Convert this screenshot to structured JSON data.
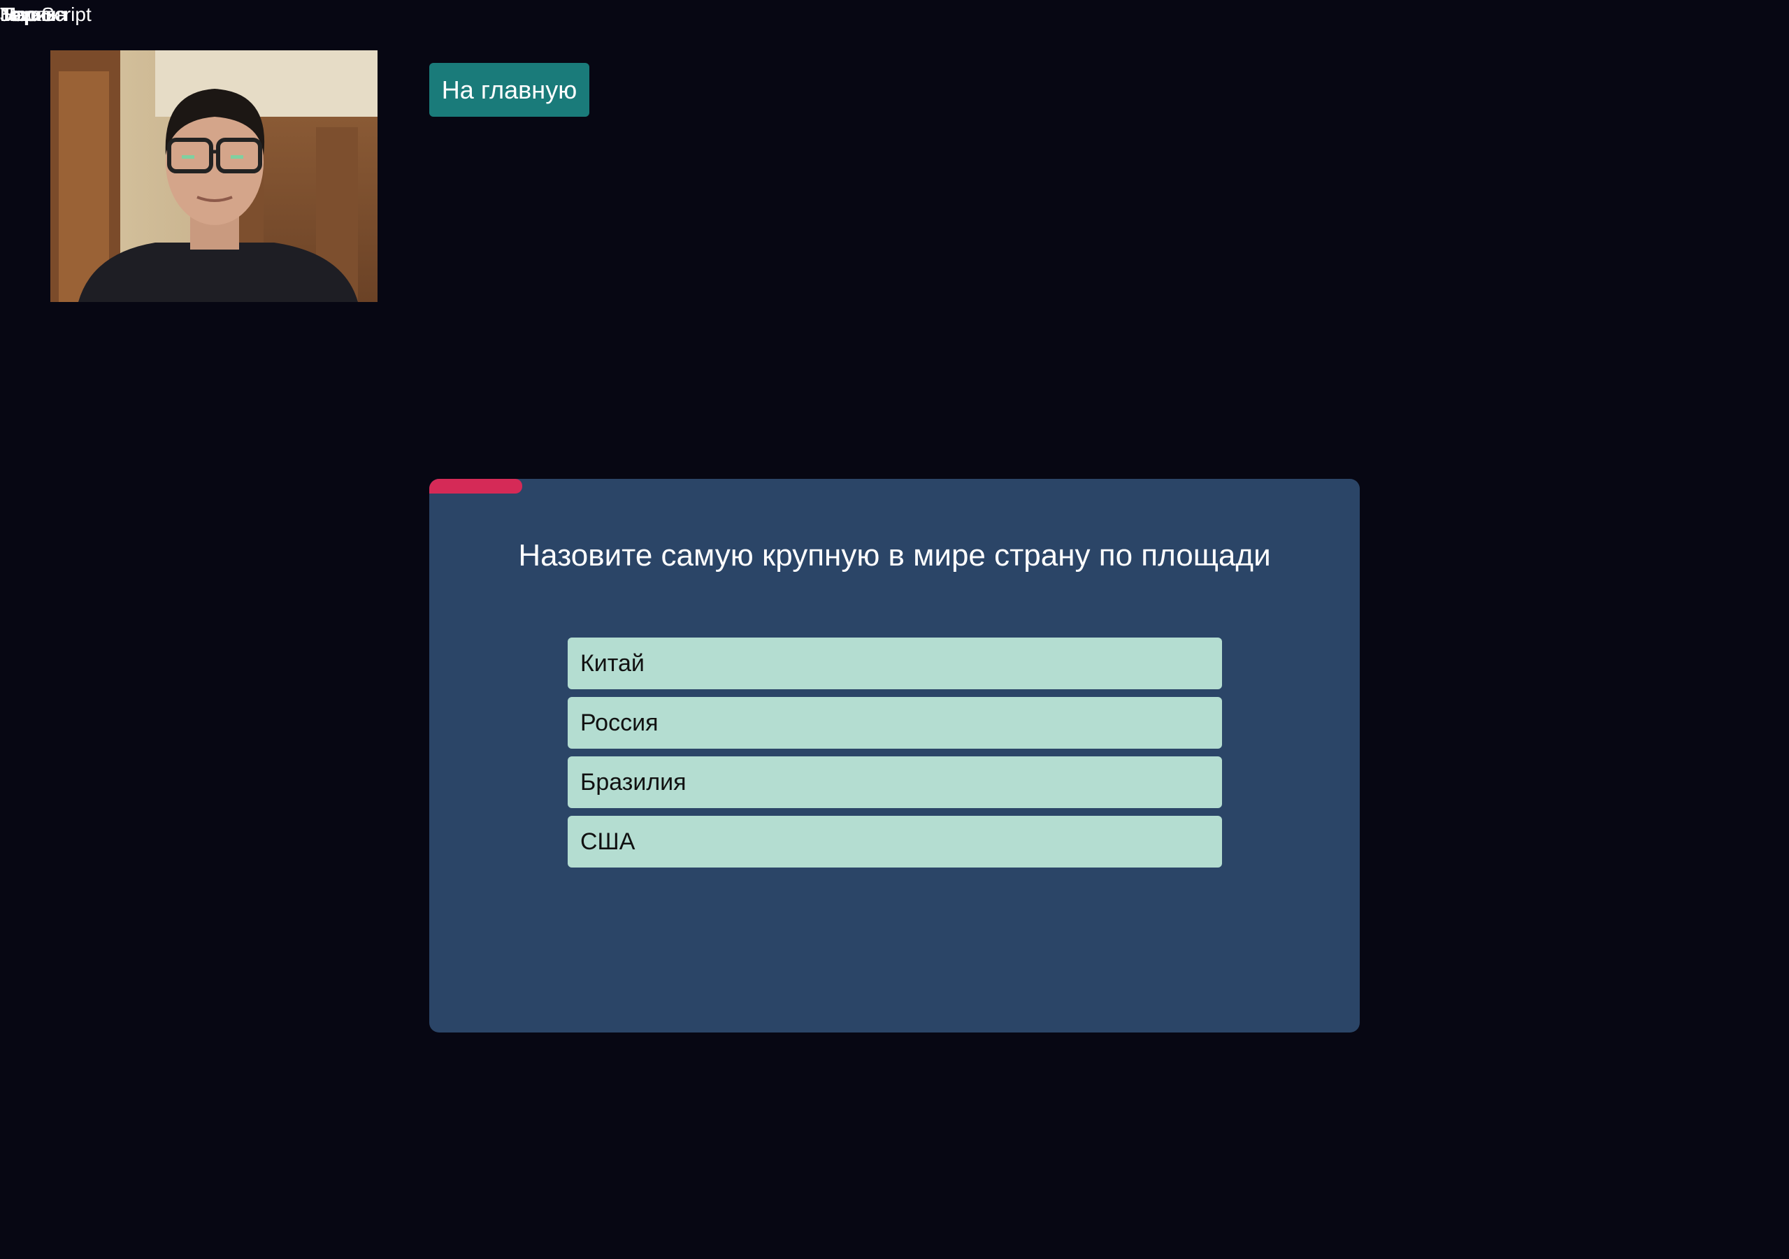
{
  "header": {
    "overlapping_labels": [
      "JavaScript",
      "Москва",
      "Париж",
      "Берлин",
      "Токио"
    ]
  },
  "webcam": {
    "icon": "webcam-feed"
  },
  "navigation": {
    "home_label": "На главную",
    "home_color": "#1a7b7a"
  },
  "quiz": {
    "timer_progress": 0.1,
    "timer_color": "#d52a57",
    "card_color": "#2b4567",
    "answer_color": "#b4ddd1",
    "question": "Назовите самую крупную в мире страну по площади",
    "answers": [
      {
        "label": "Китай"
      },
      {
        "label": "Россия"
      },
      {
        "label": "Бразилия"
      },
      {
        "label": "США"
      }
    ]
  }
}
